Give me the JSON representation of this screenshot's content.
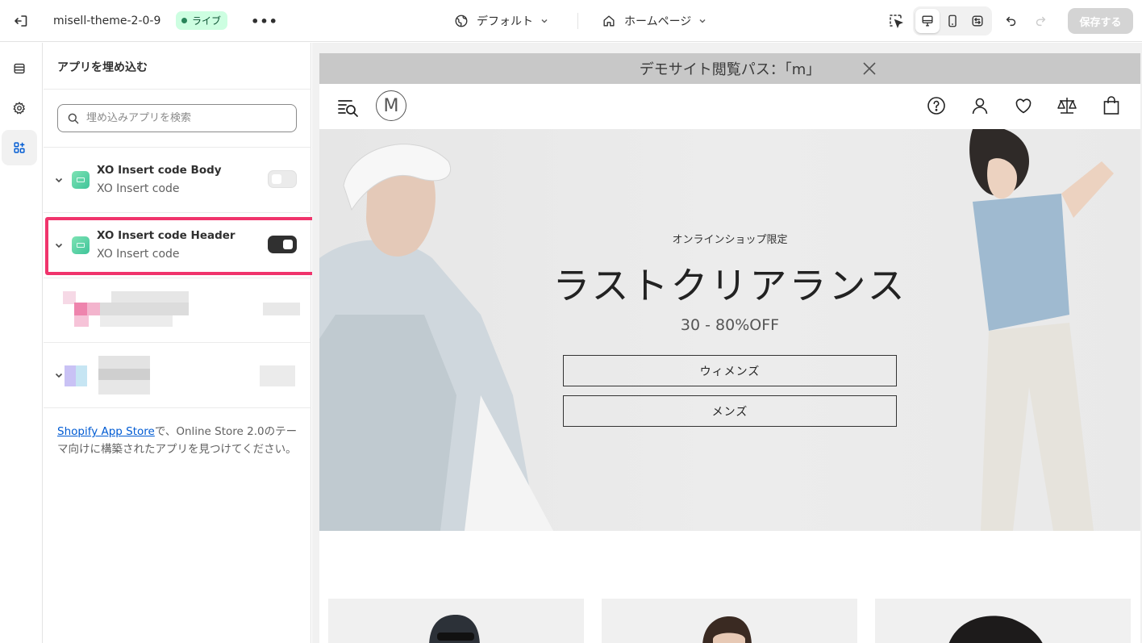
{
  "topbar": {
    "theme_name": "misell-theme-2-0-9",
    "live_label": "ライブ",
    "more_label": "•••",
    "template_picker": "デフォルト",
    "page_picker": "ホームページ",
    "save_label": "保存する"
  },
  "panel": {
    "title": "アプリを埋め込む",
    "search_placeholder": "埋め込みアプリを検索",
    "apps": [
      {
        "name": "XO Insert code Body",
        "subtitle": "XO Insert code",
        "enabled": false
      },
      {
        "name": "XO Insert code Header",
        "subtitle": "XO Insert code",
        "enabled": true
      }
    ],
    "footer_link": "Shopify App Store",
    "footer_text": "で、Online Store 2.0のテーマ向けに構築されたアプリを見つけてください。"
  },
  "preview": {
    "announcement": "デモサイト閲覧パス：「m」",
    "logo_letter": "M",
    "hero_eyebrow": "オンラインショップ限定",
    "hero_title": "ラストクリアランス",
    "hero_subtitle": "30 - 80%OFF",
    "button_women": "ウィメンズ",
    "button_men": "メンズ"
  },
  "colors": {
    "live_badge_bg": "#cdfee1",
    "highlight": "#f0346c",
    "toggle_on": "#303030",
    "link": "#005bd3"
  },
  "icons": [
    "exit-icon",
    "globe-icon",
    "home-icon",
    "chevron-down-icon",
    "inspect-icon",
    "desktop-icon",
    "mobile-icon",
    "fullwidth-icon",
    "undo-icon",
    "redo-icon",
    "sections-icon",
    "gear-icon",
    "app-embed-icon",
    "search-icon",
    "close-icon",
    "menu-search-icon",
    "help-icon",
    "account-icon",
    "heart-icon",
    "compare-icon",
    "bag-icon"
  ]
}
